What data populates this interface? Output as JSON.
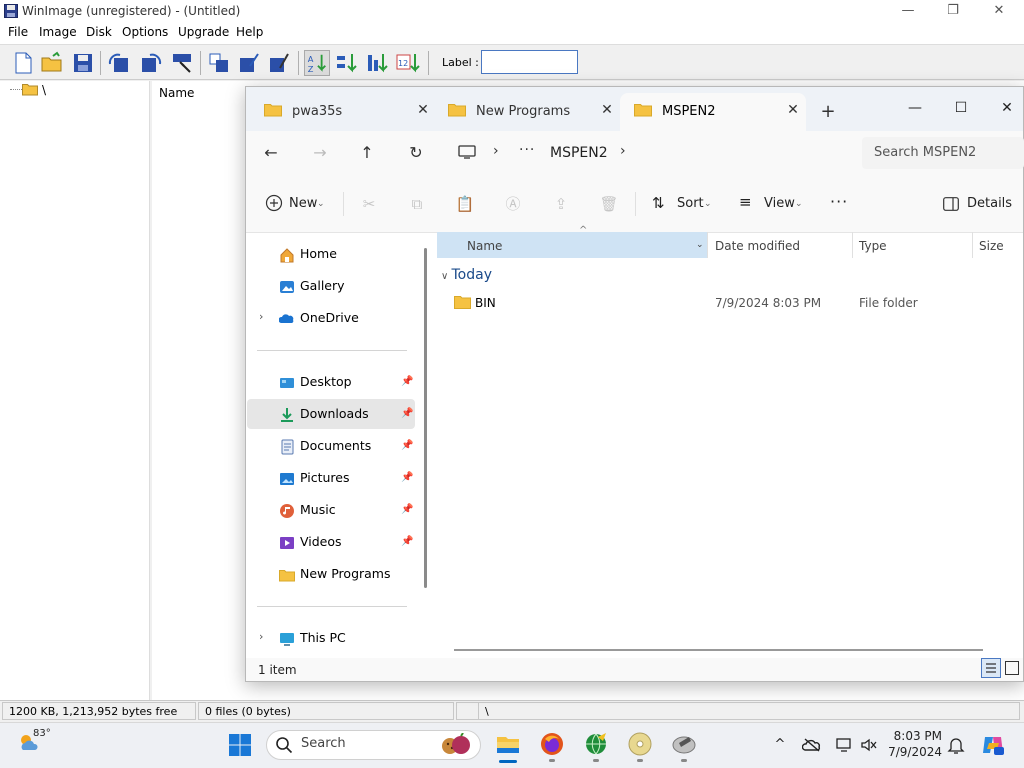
{
  "winimage": {
    "title": "WinImage (unregistered) - (Untitled)",
    "menus": [
      "File",
      "Image",
      "Disk",
      "Options",
      "Upgrade",
      "Help"
    ],
    "label_text": "Label :",
    "label_value": "",
    "tree_root": "\\",
    "column_name": "Name",
    "status": {
      "free": "1200 KB, 1,213,952 bytes free",
      "files": "0 files (0 bytes)",
      "path": "\\"
    }
  },
  "explorer": {
    "tabs": [
      {
        "label": "pwa35s",
        "active": false
      },
      {
        "label": "New Programs",
        "active": false
      },
      {
        "label": "MSPEN2",
        "active": true
      }
    ],
    "breadcrumb": {
      "more": "···",
      "current": "MSPEN2"
    },
    "search_placeholder": "Search MSPEN2",
    "commands": {
      "new": "New",
      "sort": "Sort",
      "view": "View",
      "more": "···",
      "details": "Details"
    },
    "nav": {
      "top": [
        {
          "label": "Home",
          "icon": "home-icon"
        },
        {
          "label": "Gallery",
          "icon": "gallery-icon"
        },
        {
          "label": "OneDrive",
          "icon": "onedrive-icon",
          "expandable": true
        }
      ],
      "quick": [
        {
          "label": "Desktop",
          "icon": "desktop-icon",
          "pinned": true
        },
        {
          "label": "Downloads",
          "icon": "downloads-icon",
          "pinned": true,
          "selected": true
        },
        {
          "label": "Documents",
          "icon": "documents-icon",
          "pinned": true
        },
        {
          "label": "Pictures",
          "icon": "pictures-icon",
          "pinned": true
        },
        {
          "label": "Music",
          "icon": "music-icon",
          "pinned": true
        },
        {
          "label": "Videos",
          "icon": "videos-icon",
          "pinned": true
        },
        {
          "label": "New Programs",
          "icon": "folder-icon",
          "pinned": false
        }
      ],
      "bottom": [
        {
          "label": "This PC",
          "icon": "pc-icon",
          "expandable": true
        }
      ]
    },
    "columns": {
      "name": "Name",
      "date": "Date modified",
      "type": "Type",
      "size": "Size"
    },
    "group_label": "Today",
    "files": [
      {
        "name": "BIN",
        "date": "7/9/2024 8:03 PM",
        "type": "File folder"
      }
    ],
    "status_text": "1 item"
  },
  "taskbar": {
    "temperature": "83°",
    "search_text": "Search",
    "time": "8:03 PM",
    "date": "7/9/2024"
  },
  "colors": {
    "folder": "#f5c242",
    "accent": "#0067c0",
    "selected_header": "#cfe3f4"
  }
}
